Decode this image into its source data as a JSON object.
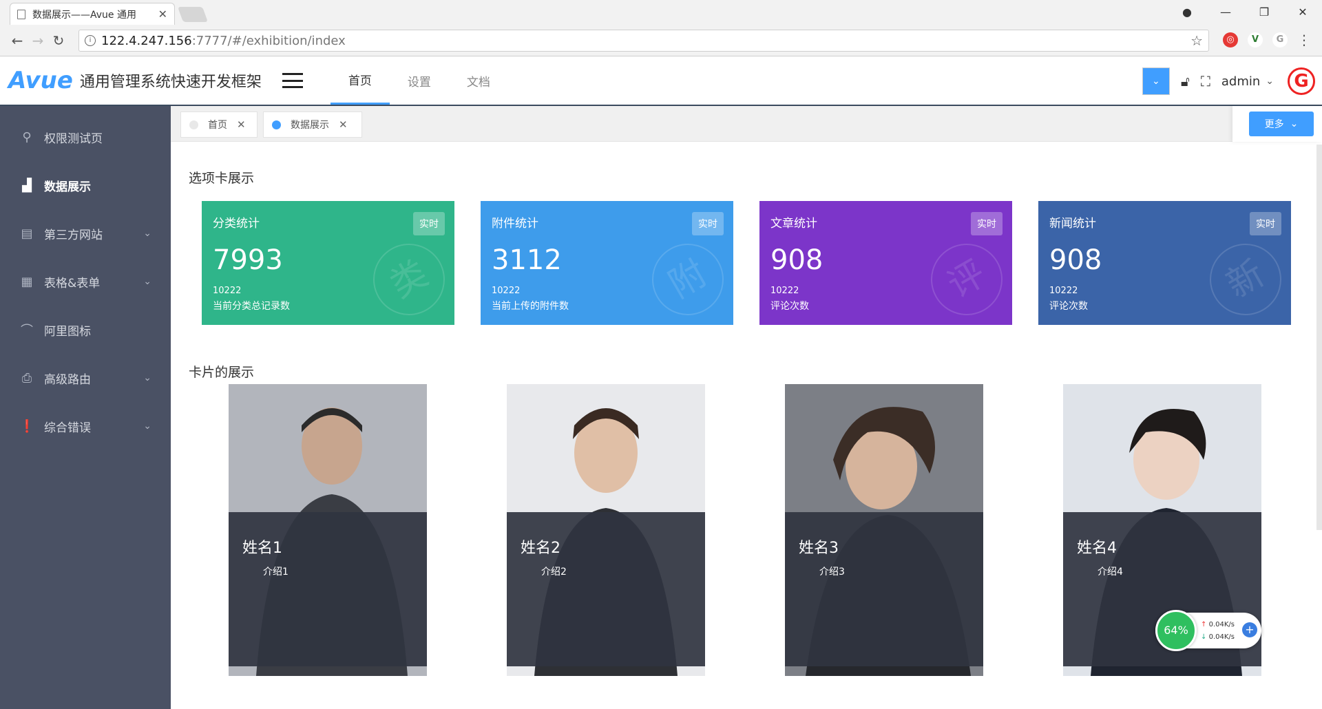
{
  "browser": {
    "tab_title": "数据展示——Avue 通用",
    "url_host": "122.4.247.156",
    "url_rest": ":7777/#/exhibition/index"
  },
  "header": {
    "logo": "Avue",
    "subtitle": "通用管理系统快速开发框架",
    "nav": [
      {
        "label": "首页",
        "active": true
      },
      {
        "label": "设置",
        "active": false
      },
      {
        "label": "文档",
        "active": false
      }
    ],
    "user": "admin"
  },
  "sidebar": {
    "items": [
      {
        "label": "权限测试页",
        "icon": "search-icon",
        "has_children": false
      },
      {
        "label": "数据展示",
        "icon": "bar-chart-icon",
        "has_children": false,
        "active": true
      },
      {
        "label": "第三方网站",
        "icon": "layout-icon",
        "has_children": true
      },
      {
        "label": "表格&表单",
        "icon": "table-icon",
        "has_children": true
      },
      {
        "label": "阿里图标",
        "icon": "iconfont-icon",
        "has_children": false
      },
      {
        "label": "高级路由",
        "icon": "printer-icon",
        "has_children": true
      },
      {
        "label": "综合错误",
        "icon": "error-icon",
        "has_children": true
      }
    ]
  },
  "tags": [
    {
      "label": "首页",
      "active": false
    },
    {
      "label": "数据展示",
      "active": true
    }
  ],
  "more_label": "更多",
  "sections": {
    "tabs_title": "选项卡展示",
    "cards_title": "卡片的展示"
  },
  "stats": [
    {
      "title": "分类统计",
      "badge": "实时",
      "value": "7993",
      "sub": "10222",
      "desc": "当前分类总记录数",
      "watermark": "类",
      "color": "#2fb58a"
    },
    {
      "title": "附件统计",
      "badge": "实时",
      "value": "3112",
      "sub": "10222",
      "desc": "当前上传的附件数",
      "watermark": "附",
      "color": "#3e9ceb"
    },
    {
      "title": "文章统计",
      "badge": "实时",
      "value": "908",
      "sub": "10222",
      "desc": "评论次数",
      "watermark": "评",
      "color": "#7c35c9"
    },
    {
      "title": "新闻统计",
      "badge": "实时",
      "value": "908",
      "sub": "10222",
      "desc": "评论次数",
      "watermark": "新",
      "color": "#3b64a8"
    }
  ],
  "people": [
    {
      "name": "姓名1",
      "intro": "介绍1"
    },
    {
      "name": "姓名2",
      "intro": "介绍2"
    },
    {
      "name": "姓名3",
      "intro": "介绍3"
    },
    {
      "name": "姓名4",
      "intro": "介绍4"
    }
  ],
  "net_widget": {
    "percent": "64%",
    "up": "0.04K/s",
    "down": "0.04K/s"
  }
}
